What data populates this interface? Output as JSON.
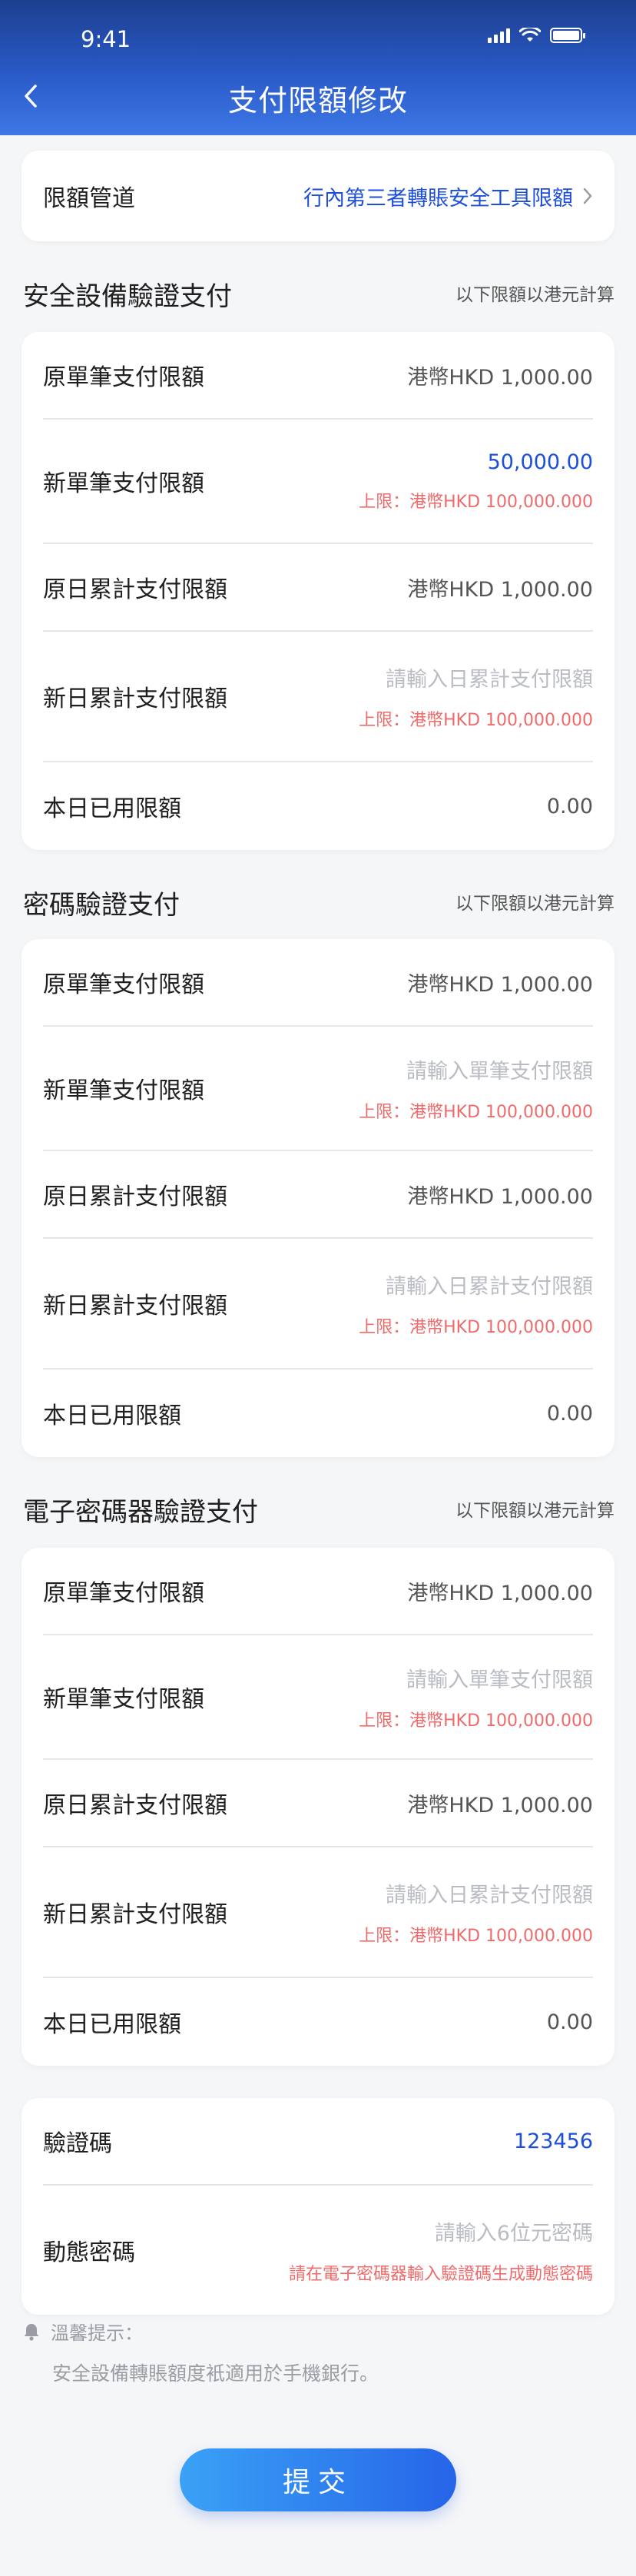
{
  "status_bar": {
    "time": "9:41"
  },
  "header": {
    "title": "支付限額修改"
  },
  "channel": {
    "label": "限額管道",
    "value": "行內第三者轉賬安全工具限額"
  },
  "sections": [
    {
      "title": "安全設備驗證支付",
      "note": "以下限額以港元計算",
      "rows": {
        "orig_single": {
          "label": "原單筆支付限額",
          "value": "港幣HKD  1,000.00"
        },
        "new_single": {
          "label": "新單筆支付限額",
          "value": "50,000.00",
          "hint": "上限：港幣HKD 100,000.000"
        },
        "orig_daily": {
          "label": "原日累計支付限額",
          "value": "港幣HKD  1,000.00"
        },
        "new_daily": {
          "label": "新日累計支付限額",
          "placeholder": "請輸入日累計支付限額",
          "hint": "上限：港幣HKD 100,000.000"
        },
        "used_today": {
          "label": "本日已用限額",
          "value": "0.00"
        }
      }
    },
    {
      "title": "密碼驗證支付",
      "note": "以下限額以港元計算",
      "rows": {
        "orig_single": {
          "label": "原單筆支付限額",
          "value": "港幣HKD  1,000.00"
        },
        "new_single": {
          "label": "新單筆支付限額",
          "placeholder": "請輸入單筆支付限額",
          "hint": "上限：港幣HKD 100,000.000"
        },
        "orig_daily": {
          "label": "原日累計支付限額",
          "value": "港幣HKD  1,000.00"
        },
        "new_daily": {
          "label": "新日累計支付限額",
          "placeholder": "請輸入日累計支付限額",
          "hint": "上限：港幣HKD 100,000.000"
        },
        "used_today": {
          "label": "本日已用限額",
          "value": "0.00"
        }
      }
    },
    {
      "title": "電子密碼器驗證支付",
      "note": "以下限額以港元計算",
      "rows": {
        "orig_single": {
          "label": "原單筆支付限額",
          "value": "港幣HKD  1,000.00"
        },
        "new_single": {
          "label": "新單筆支付限額",
          "placeholder": "請輸入單筆支付限額",
          "hint": "上限：港幣HKD 100,000.000"
        },
        "orig_daily": {
          "label": "原日累計支付限額",
          "value": "港幣HKD  1,000.00"
        },
        "new_daily": {
          "label": "新日累計支付限額",
          "placeholder": "請輸入日累計支付限額",
          "hint": "上限：港幣HKD 100,000.000"
        },
        "used_today": {
          "label": "本日已用限額",
          "value": "0.00"
        }
      }
    }
  ],
  "verification": {
    "code_label": "驗證碼",
    "code_value": "123456",
    "dynamic_label": "動態密碼",
    "dynamic_placeholder": "請輸入6位元密碼",
    "dynamic_hint": "請在電子密碼器輸入驗證碼生成動態密碼"
  },
  "tip": {
    "title": "溫馨提示：",
    "text": "安全設備轉賬額度衹適用於手機銀行。"
  },
  "submit_label": "提交",
  "colors": {
    "header_start": "#1c3f8f",
    "header_end": "#3d78e6",
    "accent_blue": "#1d4fd8",
    "hint_red": "#ef6b6b"
  }
}
